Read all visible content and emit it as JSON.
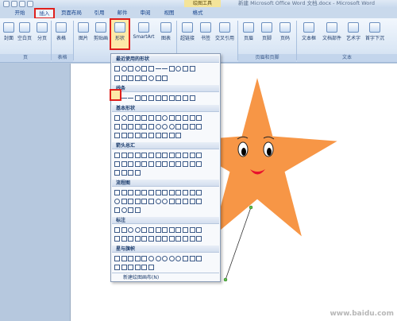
{
  "window": {
    "title": "新建 Microsoft Office Word 文档.docx - Microsoft Word",
    "context_tools": "绘图工具"
  },
  "tabs": [
    {
      "label": "开始"
    },
    {
      "label": "插入"
    },
    {
      "label": "页面布局"
    },
    {
      "label": "引用"
    },
    {
      "label": "邮件"
    },
    {
      "label": "审阅"
    },
    {
      "label": "视图"
    },
    {
      "label": "格式"
    }
  ],
  "ribbon": {
    "buttons": [
      {
        "label": "封面"
      },
      {
        "label": "空白页"
      },
      {
        "label": "分页"
      },
      {
        "label": "表格"
      },
      {
        "label": "图片"
      },
      {
        "label": "剪贴画"
      },
      {
        "label": "形状"
      },
      {
        "label": "SmartArt"
      },
      {
        "label": "图表"
      },
      {
        "label": "超链接"
      },
      {
        "label": "书签"
      },
      {
        "label": "交叉引用"
      },
      {
        "label": "页眉"
      },
      {
        "label": "页脚"
      },
      {
        "label": "页码"
      },
      {
        "label": "文本框"
      },
      {
        "label": "文档部件"
      },
      {
        "label": "艺术字"
      },
      {
        "label": "首字下沉"
      }
    ],
    "groups": [
      {
        "label": "页"
      },
      {
        "label": "表格"
      },
      {
        "label": "页眉和页脚"
      },
      {
        "label": "文本"
      }
    ]
  },
  "shapes_menu": {
    "categories": [
      {
        "label": "最近使用的形状"
      },
      {
        "label": "线条"
      },
      {
        "label": "基本形状"
      },
      {
        "label": "箭头总汇"
      },
      {
        "label": "流程图"
      },
      {
        "label": "标注"
      },
      {
        "label": "星与旗帜"
      }
    ],
    "footer": "新建绘图画布(N)"
  },
  "watermark": "www.baidu.com",
  "colors": {
    "star_fill": "#f79646",
    "highlight": "#e0201c",
    "ribbon_text": "#15428b"
  }
}
